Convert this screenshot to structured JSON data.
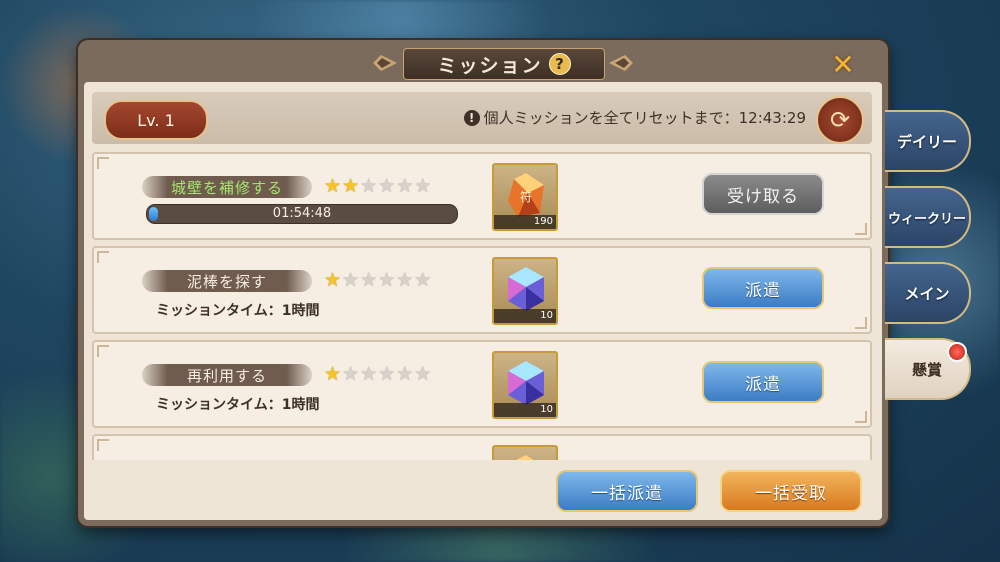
{
  "title": "ミッション",
  "help_icon": "?",
  "close_icon": "✕",
  "level": "Lv. 1",
  "reset_text": "個人ミッションを全てリセットまで：12:43:29",
  "reset_alert_icon": "!",
  "refresh_icon": "⟳",
  "missions": [
    {
      "name": "城壁を補修する",
      "stars": 2,
      "max_stars": 6,
      "progress_text": "01:54:48",
      "progress": 0.03,
      "reward_icon": "orange-crystal-icon",
      "reward_qty": "190",
      "button": "受け取る"
    },
    {
      "name": "泥棒を探す",
      "stars": 1,
      "max_stars": 6,
      "time_text": "ミッションタイム：1時間",
      "reward_icon": "blue-crystal-icon",
      "reward_qty": "10",
      "button": "派遣"
    },
    {
      "name": "再利用する",
      "stars": 1,
      "max_stars": 6,
      "time_text": "ミッションタイム：1時間",
      "reward_icon": "blue-crystal-icon",
      "reward_qty": "10",
      "button": "派遣"
    }
  ],
  "bulk_dispatch": "一括派遣",
  "bulk_claim": "一括受取",
  "tabs": [
    {
      "label": "デイリー",
      "selected": false
    },
    {
      "label": "ウィークリー",
      "selected": false
    },
    {
      "label": "メイン",
      "selected": false
    },
    {
      "label": "懸賞",
      "selected": true,
      "notification": true
    }
  ],
  "colors": {
    "panel": "#efe5d7",
    "accent_orange": "#d97a1f",
    "accent_blue": "#3c7cc4",
    "star": "#f7c428"
  }
}
